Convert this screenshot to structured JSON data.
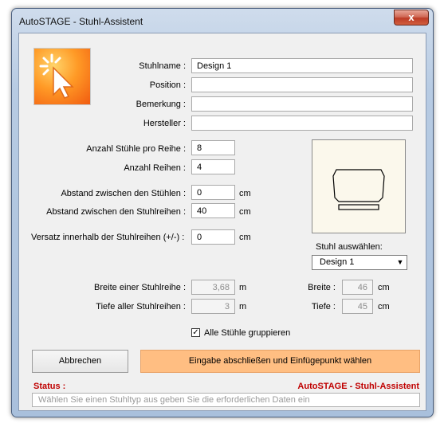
{
  "window": {
    "title": "AutoSTAGE - Stuhl-Assistent",
    "close_glyph": "x"
  },
  "fields": {
    "stuhlname": {
      "label": "Stuhlname :",
      "value": "Design 1"
    },
    "position": {
      "label": "Position :",
      "value": ""
    },
    "bemerkung": {
      "label": "Bemerkung :",
      "value": ""
    },
    "hersteller": {
      "label": "Hersteller :",
      "value": ""
    },
    "anzahl_stuehle": {
      "label": "Anzahl Stühle pro Reihe :",
      "value": "8"
    },
    "anzahl_reihen": {
      "label": "Anzahl Reihen :",
      "value": "4"
    },
    "abstand_stuehle": {
      "label": "Abstand zwischen den Stühlen :",
      "value": "0",
      "unit": "cm"
    },
    "abstand_reihen": {
      "label": "Abstand zwischen den Stuhlreihen :",
      "value": "40",
      "unit": "cm"
    },
    "versatz": {
      "label": "Versatz innerhalb der Stuhlreihen (+/-) :",
      "value": "0",
      "unit": "cm"
    },
    "breite_reihe": {
      "label": "Breite einer Stuhlreihe :",
      "value": "3,68",
      "unit": "m"
    },
    "tiefe_reihen": {
      "label": "Tiefe aller Stuhlreihen :",
      "value": "3",
      "unit": "m"
    },
    "breite": {
      "label": "Breite :",
      "value": "46",
      "unit": "cm"
    },
    "tiefe": {
      "label": "Tiefe :",
      "value": "45",
      "unit": "cm"
    }
  },
  "chair_select": {
    "label": "Stuhl auswählen:",
    "value": "Design 1"
  },
  "group_checkbox": {
    "label": "Alle Stühle gruppieren",
    "checked": true
  },
  "buttons": {
    "cancel": "Abbrechen",
    "confirm": "Eingabe abschließen und Einfügepunkt wählen"
  },
  "status": {
    "label": "Status :",
    "brand": "AutoSTAGE - Stuhl-Assistent",
    "message": "Wählen Sie einen Stuhltyp aus geben Sie die erforderlichen Daten ein"
  },
  "colors": {
    "accent_orange": "#ffbe82",
    "status_red": "#c00000"
  },
  "icons": {
    "logo": "cursor-click-icon",
    "dropdown": "chevron-down-icon",
    "close": "close-icon"
  }
}
